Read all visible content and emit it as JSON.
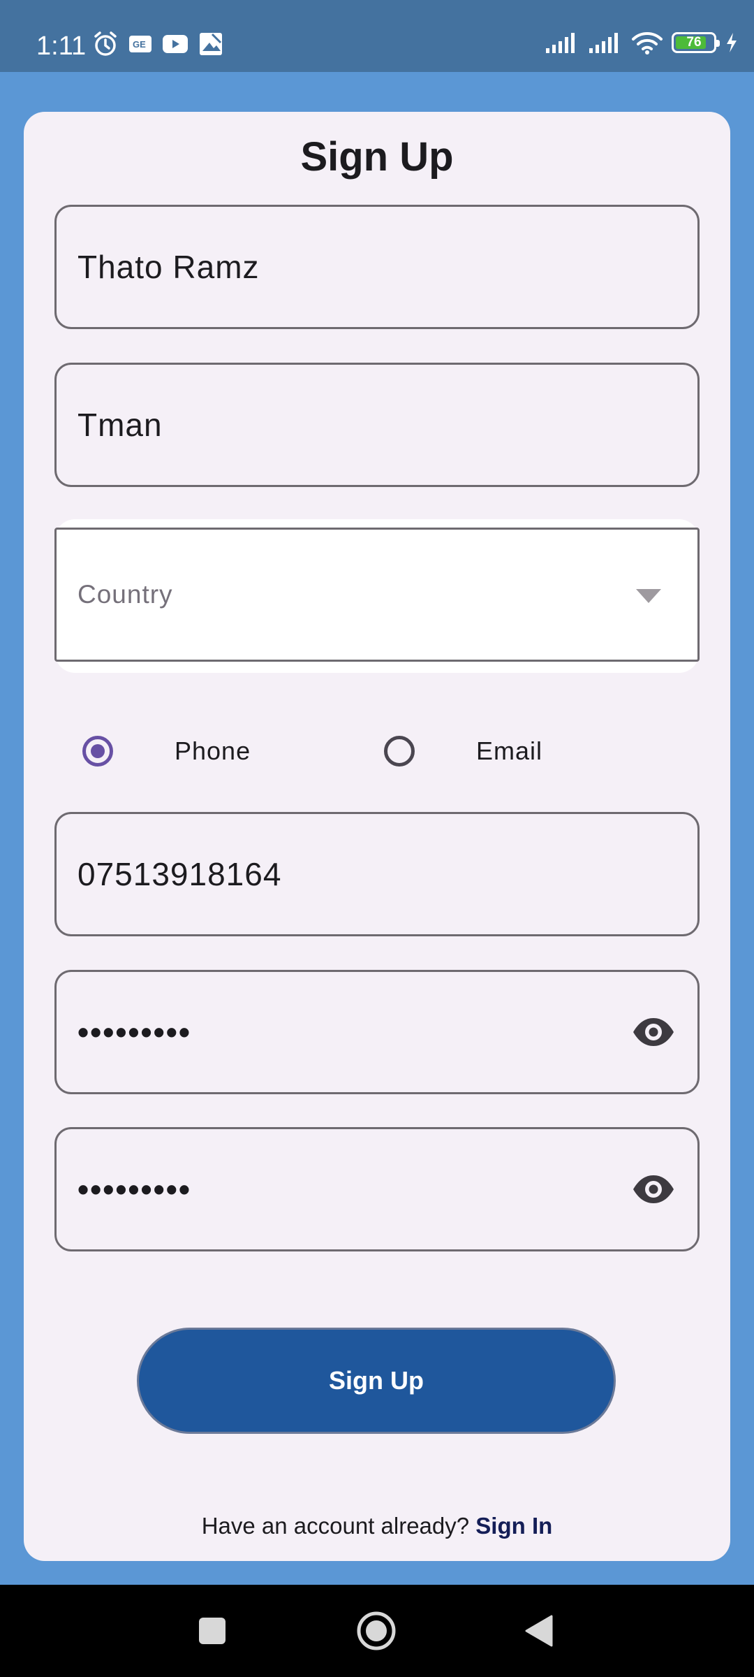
{
  "status_bar": {
    "time": "1:11",
    "battery_level": "76",
    "icons_left": [
      "alarm-icon",
      "news-icon",
      "youtube-icon",
      "gallery-icon"
    ],
    "icons_right": [
      "signal-icon",
      "signal-icon",
      "wifi-icon",
      "battery-icon",
      "charging-icon"
    ]
  },
  "form": {
    "title": "Sign Up",
    "full_name": "Thato Ramz",
    "username": "Tman",
    "country_placeholder": "Country",
    "contact_method": {
      "options": [
        "Phone",
        "Email"
      ],
      "selected": "Phone"
    },
    "phone": "07513918164",
    "password": "•••••••••",
    "confirm_password": "•••••••••",
    "submit_label": "Sign Up",
    "footer_text": "Have an account already?",
    "footer_link": "Sign In"
  },
  "colors": {
    "background": "#5b97d5",
    "status_bar": "#44729f",
    "card": "#f5f0f7",
    "button": "#1f579c",
    "radio_accent": "#6750a4",
    "link": "#141e57"
  }
}
